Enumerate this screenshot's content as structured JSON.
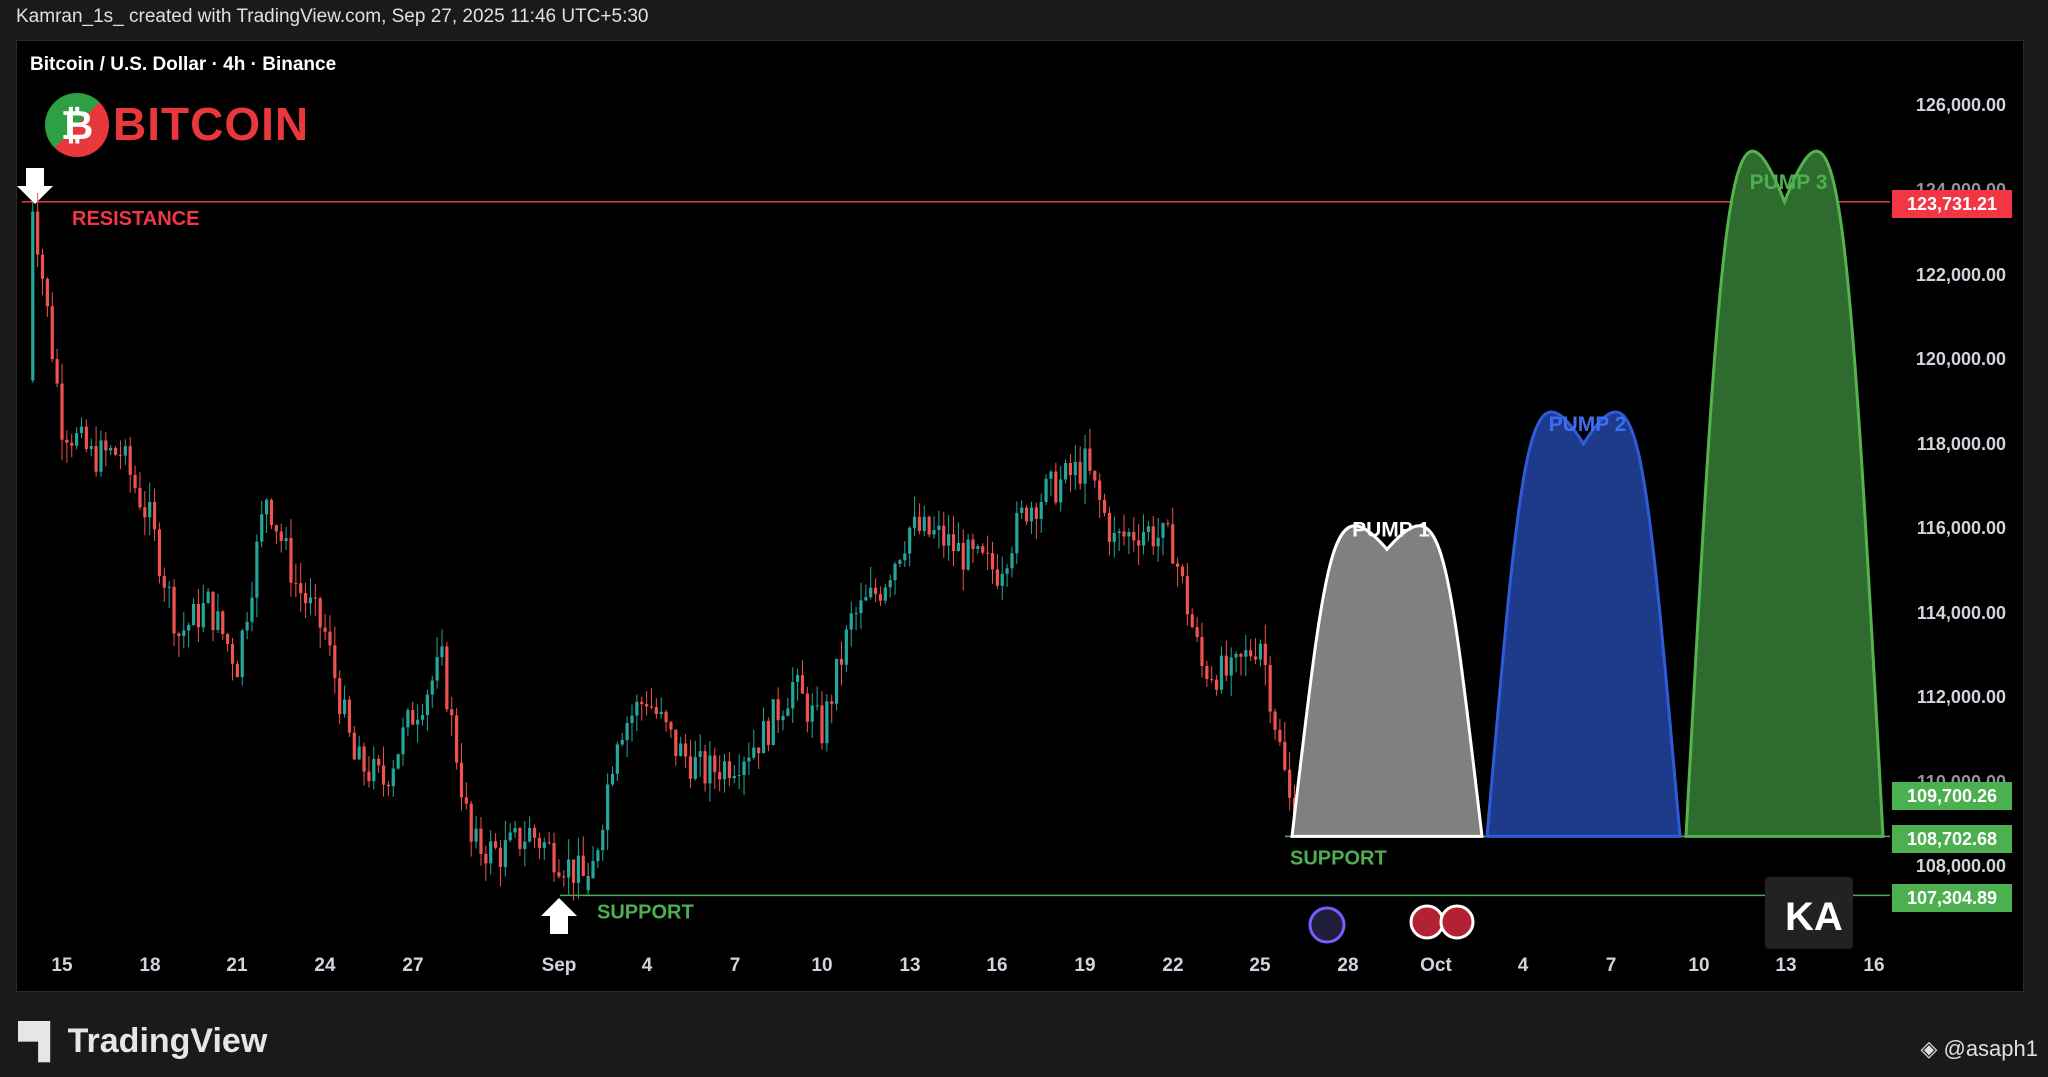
{
  "header": {
    "credit": "Kamran_1s_ created with TradingView.com, Sep 27, 2025 11:46 UTC+5:30",
    "symbol": "Bitcoin / U.S. Dollar · 4h · Binance"
  },
  "logo": {
    "text": "BITCOIN",
    "glyph": "₿"
  },
  "footer": {
    "brand": "TradingView",
    "watermark": "@asaph1"
  },
  "colors": {
    "up": "#26a69a",
    "down": "#ef5350",
    "resistance": "#f23645",
    "support": "#4caf50",
    "pump1": "#808080",
    "pump2": "#1e3a8a",
    "pump3": "#2e6b2e"
  },
  "chart_data": {
    "type": "candlestick",
    "title": "Bitcoin / U.S. Dollar · 4h · Binance",
    "ylim": [
      105000,
      127500
    ],
    "y_ticks": [
      "126,000.00",
      "122,000.00",
      "120,000.00",
      "118,000.00",
      "116,000.00",
      "114,000.00",
      "112,000.00",
      "108,000.00"
    ],
    "y_ticks_partial": [
      "124,000.00",
      "110,000.00"
    ],
    "x_ticks": [
      "15",
      "18",
      "21",
      "24",
      "27",
      "Sep",
      "4",
      "7",
      "10",
      "13",
      "16",
      "19",
      "22",
      "25",
      "28",
      "Oct",
      "4",
      "7",
      "10",
      "13",
      "16"
    ],
    "price_path": [
      {
        "date": "Aug 14",
        "price": 119500
      },
      {
        "date": "Aug 14",
        "price": 123731
      },
      {
        "date": "Aug 15",
        "price": 118500
      },
      {
        "date": "Aug 16",
        "price": 117700
      },
      {
        "date": "Aug 17",
        "price": 117800
      },
      {
        "date": "Aug 18",
        "price": 116200
      },
      {
        "date": "Aug 19",
        "price": 113500
      },
      {
        "date": "Aug 20",
        "price": 114200
      },
      {
        "date": "Aug 21",
        "price": 112800
      },
      {
        "date": "Aug 22",
        "price": 116800
      },
      {
        "date": "Aug 23",
        "price": 114700
      },
      {
        "date": "Aug 24",
        "price": 113500
      },
      {
        "date": "Aug 25",
        "price": 110500
      },
      {
        "date": "Aug 26",
        "price": 110000
      },
      {
        "date": "Aug 27",
        "price": 111600
      },
      {
        "date": "Aug 28",
        "price": 112800
      },
      {
        "date": "Aug 29",
        "price": 108500
      },
      {
        "date": "Aug 30",
        "price": 108300
      },
      {
        "date": "Aug 31",
        "price": 108800
      },
      {
        "date": "Sep 1",
        "price": 107600
      },
      {
        "date": "Sep 1",
        "price": 107305
      },
      {
        "date": "Sep 2",
        "price": 111200
      },
      {
        "date": "Sep 3",
        "price": 112000
      },
      {
        "date": "Sep 4",
        "price": 110800
      },
      {
        "date": "Sep 5",
        "price": 110200
      },
      {
        "date": "Sep 6",
        "price": 110500
      },
      {
        "date": "Sep 7",
        "price": 111100
      },
      {
        "date": "Sep 8",
        "price": 112300
      },
      {
        "date": "Sep 9",
        "price": 111200
      },
      {
        "date": "Sep 10",
        "price": 113800
      },
      {
        "date": "Sep 11",
        "price": 114600
      },
      {
        "date": "Sep 12",
        "price": 116000
      },
      {
        "date": "Sep 13",
        "price": 115800
      },
      {
        "date": "Sep 14",
        "price": 115300
      },
      {
        "date": "Sep 15",
        "price": 115000
      },
      {
        "date": "Sep 16",
        "price": 116500
      },
      {
        "date": "Sep 17",
        "price": 117000
      },
      {
        "date": "Sep 18",
        "price": 117500
      },
      {
        "date": "Sep 19",
        "price": 115700
      },
      {
        "date": "Sep 20",
        "price": 116000
      },
      {
        "date": "Sep 21",
        "price": 115600
      },
      {
        "date": "Sep 22",
        "price": 112700
      },
      {
        "date": "Sep 23",
        "price": 112500
      },
      {
        "date": "Sep 24",
        "price": 113400
      },
      {
        "date": "Sep 25",
        "price": 109500
      },
      {
        "date": "Sep 26",
        "price": 109700
      }
    ],
    "resistance": {
      "label": "RESISTANCE",
      "price": 123731.21
    },
    "support_low": {
      "label": "SUPPORT",
      "price": 107304.89
    },
    "support_high": {
      "label": "SUPPORT",
      "price": 108702.68
    },
    "current_price": 109700.26,
    "projections": [
      {
        "label": "PUMP 1",
        "peak": 115500
      },
      {
        "label": "PUMP 2",
        "peak": 118000
      },
      {
        "label": "PUMP 3",
        "peak": 123731
      }
    ],
    "price_tags": [
      {
        "value": "123,731.21",
        "color": "#f23645"
      },
      {
        "value": "109,700.26",
        "color": "#4caf50"
      },
      {
        "value": "108,702.68",
        "color": "#4caf50"
      },
      {
        "value": "107,304.89",
        "color": "#4caf50"
      }
    ]
  }
}
